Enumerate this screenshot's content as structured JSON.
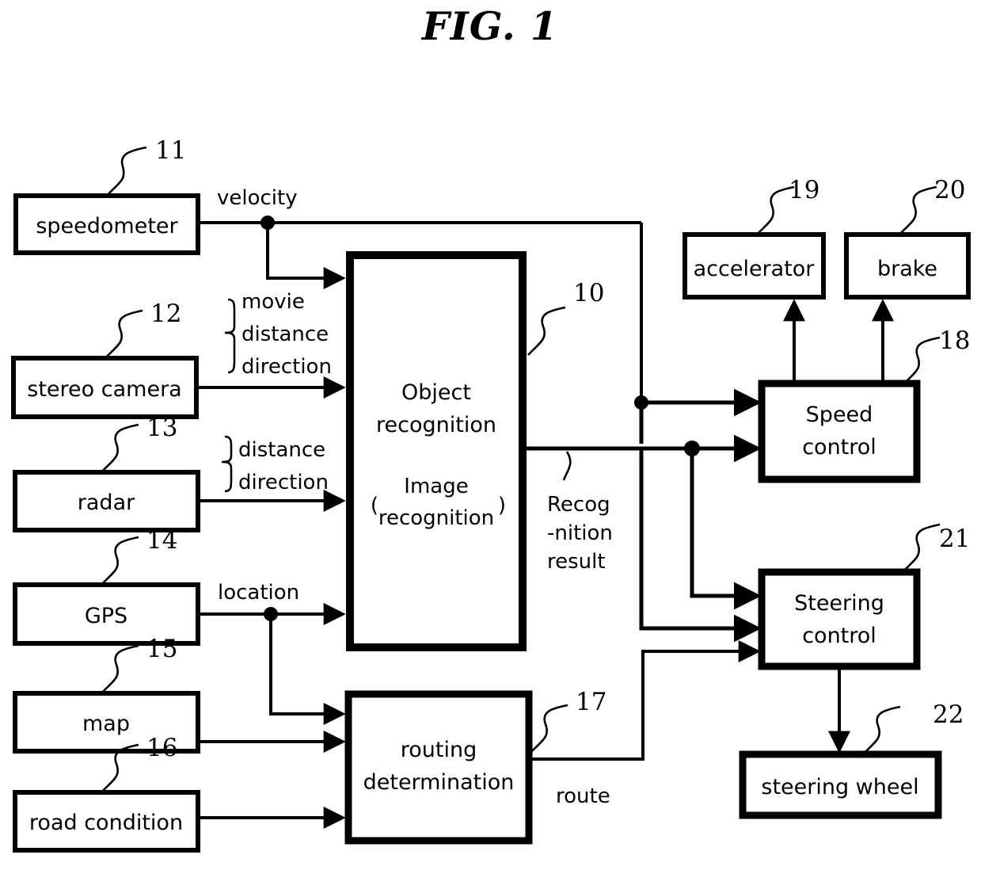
{
  "figure": {
    "title": "FIG. 1"
  },
  "blocks": [
    {
      "id": "speedometer",
      "label": "speedometer",
      "ref": "11"
    },
    {
      "id": "stereo_camera",
      "label": "stereo camera",
      "ref": "12"
    },
    {
      "id": "radar",
      "label": "radar",
      "ref": "13"
    },
    {
      "id": "gps",
      "label": "GPS",
      "ref": "14"
    },
    {
      "id": "map",
      "label": "map",
      "ref": "15"
    },
    {
      "id": "road_condition",
      "label": "road condition",
      "ref": "16"
    },
    {
      "id": "object_recognition",
      "label_line1": "Object",
      "label_line2": "recognition",
      "sub_line1": "Image",
      "sub_line2": "recognition",
      "sub_open": "(",
      "sub_close": ")",
      "ref": "10"
    },
    {
      "id": "routing_determination",
      "label_line1": "routing",
      "label_line2": "determination",
      "ref": "17"
    },
    {
      "id": "speed_control",
      "label_line1": "Speed",
      "label_line2": "control",
      "ref": "18"
    },
    {
      "id": "accelerator",
      "label": "accelerator",
      "ref": "19"
    },
    {
      "id": "brake",
      "label": "brake",
      "ref": "20"
    },
    {
      "id": "steering_control",
      "label_line1": "Steering",
      "label_line2": "control",
      "ref": "21"
    },
    {
      "id": "steering_wheel",
      "label": "steering wheel",
      "ref": "22"
    }
  ],
  "signals": {
    "velocity": "velocity",
    "camera_group": {
      "line1": "movie",
      "line2": "distance",
      "line3": "direction"
    },
    "radar_group": {
      "line1": "distance",
      "line2": "direction"
    },
    "location": "location",
    "recognition_result": {
      "line1": "Recog",
      "line2": "-nition",
      "line3": "result"
    },
    "route": "route"
  },
  "colors": {
    "ink": "#000000",
    "paper": "#ffffff"
  }
}
